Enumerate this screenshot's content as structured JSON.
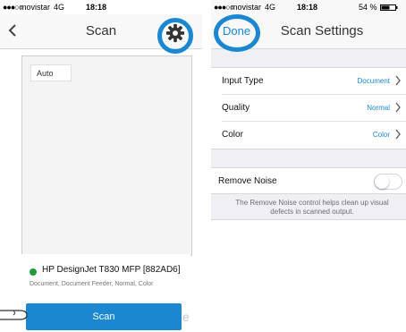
{
  "status_left": {
    "signal": "●●●○○",
    "carrier": "movistar",
    "network": "4G",
    "time": "18:18"
  },
  "status_right": {
    "signal": "●●●○○",
    "carrier": "movistar",
    "network": "4G",
    "time": "18:18",
    "battery": "54 %"
  },
  "scan_screen": {
    "title": "Scan",
    "mode_label": "Auto",
    "printer": {
      "name": "HP DesignJet T830 MFP [882AD6]",
      "details": "Document, Document Feeder, Normal, Color",
      "status_color": "#1f9a3e"
    },
    "scan_button": "Scan"
  },
  "settings_screen": {
    "done": "Done",
    "title": "Scan Settings",
    "rows": [
      {
        "label": "Input Type",
        "value": "Document"
      },
      {
        "label": "Quality",
        "value": "Normal"
      },
      {
        "label": "Color",
        "value": "Color"
      }
    ],
    "remove_noise": {
      "label": "Remove Noise",
      "enabled": false,
      "help": "The Remove Noise control helps clean up visual defects in scanned output."
    }
  },
  "colors": {
    "accent": "#1a87d0",
    "background": "#efeff4"
  }
}
